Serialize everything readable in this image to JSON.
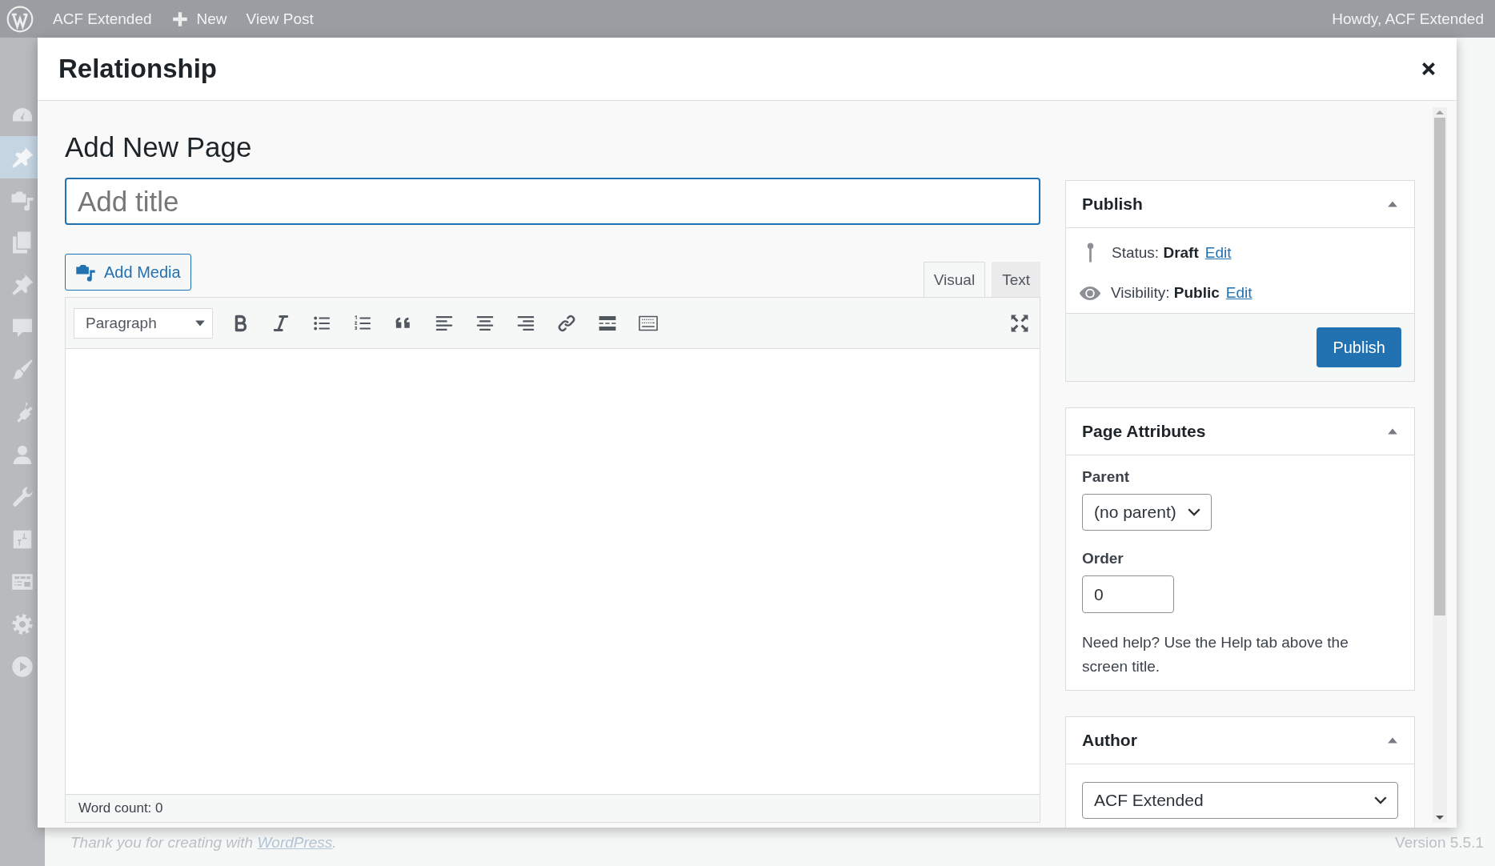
{
  "admin_bar": {
    "site_name": "ACF Extended",
    "new_label": "New",
    "view_post": "View Post",
    "greeting": "Howdy, ACF Extended"
  },
  "admin_menu": [
    {
      "kind": "dashboard",
      "selected": false
    },
    {
      "kind": "pin",
      "selected": true
    },
    {
      "kind": "media",
      "selected": false
    },
    {
      "kind": "pages",
      "selected": false
    },
    {
      "kind": "pin",
      "selected": false
    },
    {
      "kind": "comment",
      "selected": false
    },
    {
      "kind": "brush",
      "selected": false
    },
    {
      "kind": "plug",
      "selected": false
    },
    {
      "kind": "user",
      "selected": false
    },
    {
      "kind": "wrench",
      "selected": false
    },
    {
      "kind": "sliders",
      "selected": false
    },
    {
      "kind": "table",
      "selected": false
    },
    {
      "kind": "gear",
      "selected": false
    },
    {
      "kind": "play",
      "selected": false
    }
  ],
  "modal": {
    "title": "Relationship",
    "heading": "Add New Page",
    "title_field": {
      "placeholder": "Add title"
    },
    "add_media": "Add Media",
    "editor_tabs": [
      {
        "label": "Visual",
        "selected": true
      },
      {
        "label": "Text",
        "selected": false
      }
    ],
    "format_select": "Paragraph",
    "toolbar": [
      {
        "kind": "bold"
      },
      {
        "kind": "italic"
      },
      {
        "kind": "bullet-list"
      },
      {
        "kind": "numbered-list"
      },
      {
        "kind": "quote"
      },
      {
        "kind": "align-left"
      },
      {
        "kind": "align-center"
      },
      {
        "kind": "align-right"
      },
      {
        "kind": "link"
      },
      {
        "kind": "read-more"
      },
      {
        "kind": "keyboard"
      }
    ],
    "word_count": "Word count: 0",
    "publish_box": {
      "title": "Publish",
      "expanded": true,
      "rows": [
        {
          "kind": "status",
          "label": "Status:",
          "value": "Draft",
          "link": "Edit"
        },
        {
          "kind": "visibility",
          "label": "Visibility:",
          "value": "Public",
          "link": "Edit"
        }
      ],
      "button": "Publish"
    },
    "attributes_box": {
      "title": "Page Attributes",
      "expanded": true,
      "parent_label": "Parent",
      "parent": "(no parent)",
      "order_label": "Order",
      "order": "0",
      "help": "Need help? Use the Help tab above the screen title."
    },
    "author_box": {
      "title": "Author",
      "expanded": true,
      "author": "ACF Extended"
    }
  },
  "footer": {
    "thanks": "Thank you for creating with",
    "link": "WordPress",
    "suffix": ".",
    "version": "Version 5.5.1"
  }
}
